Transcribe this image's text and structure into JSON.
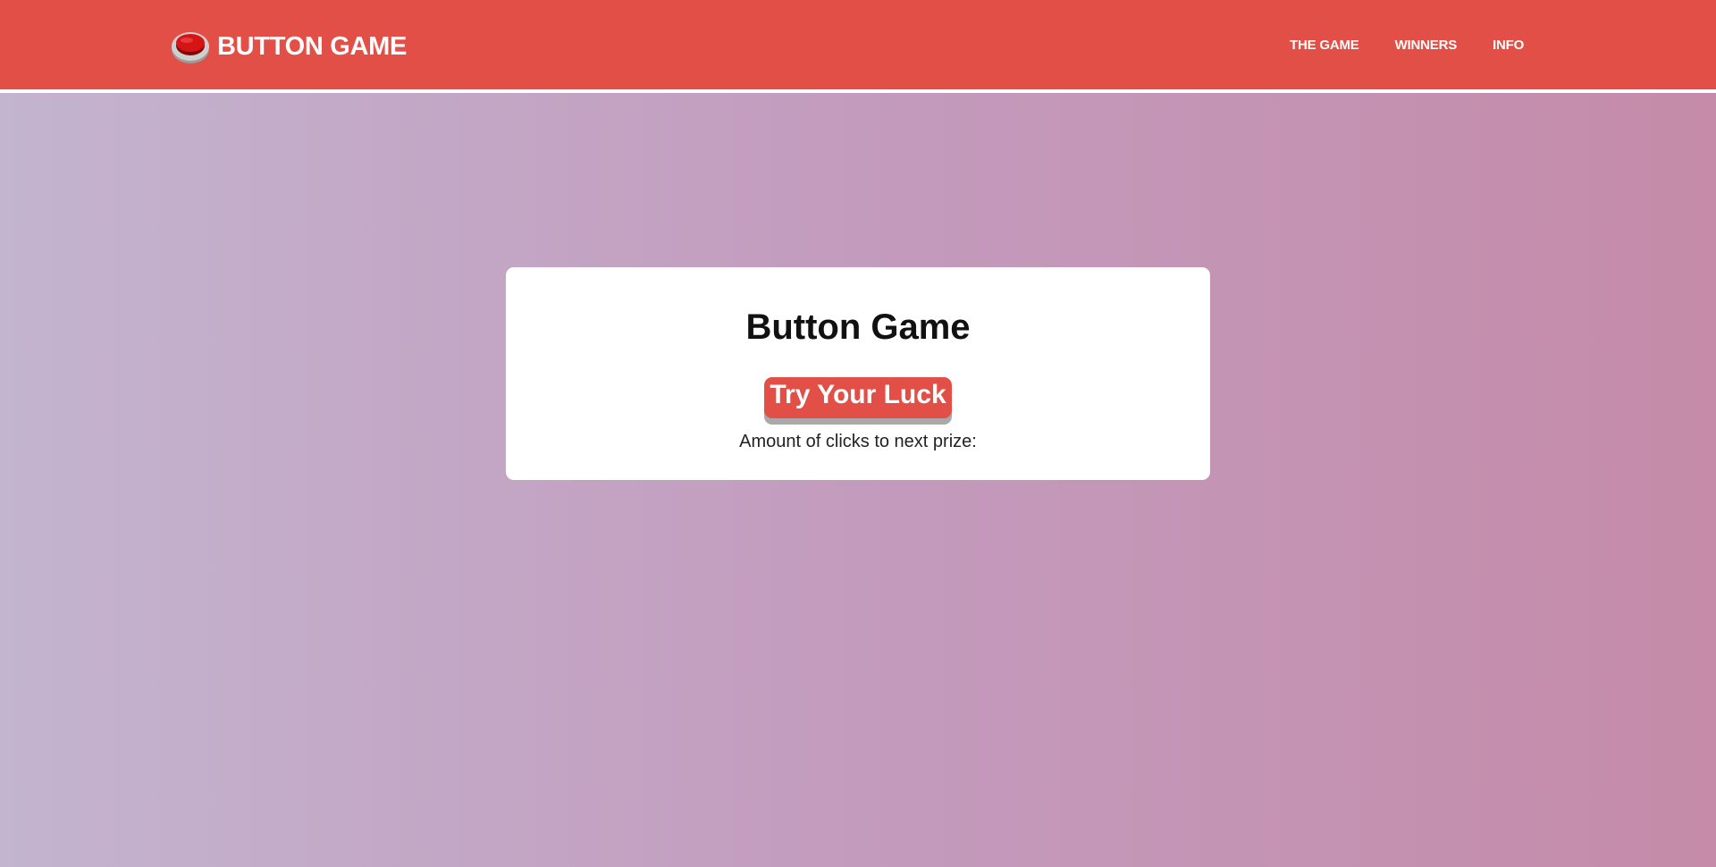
{
  "header": {
    "brand_name": "BUTTON GAME",
    "logo_icon": "red-button-icon",
    "nav": [
      {
        "label": "THE GAME"
      },
      {
        "label": "WINNERS"
      },
      {
        "label": "INFO"
      }
    ]
  },
  "main": {
    "card_title": "Button Game",
    "action_button_label": "Try Your Luck",
    "prize_text": "Amount of clicks to next prize:"
  },
  "colors": {
    "brand_red": "#e24f46",
    "background_left": "#c3b4cf",
    "background_right": "#c58ba9",
    "card_bg": "#ffffff",
    "button_shadow": "#a9a9a9"
  }
}
